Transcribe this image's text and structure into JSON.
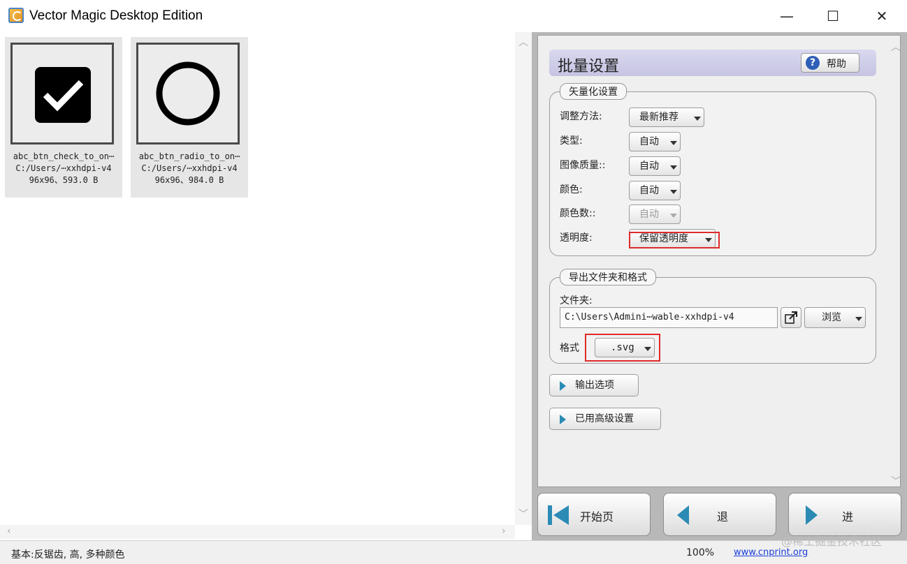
{
  "window": {
    "title": "Vector Magic Desktop Edition",
    "minimize_glyph": "—",
    "maximize_glyph": "☐",
    "close_glyph": "✕",
    "icon": "vector-magic-logo"
  },
  "files": [
    {
      "name": "abc_btn_check_to_on⋯",
      "path": "C:/Users/⋯xxhdpi-v4",
      "info": "96x96、593.0 B",
      "icon": "checkbox-checked-icon"
    },
    {
      "name": "abc_btn_radio_to_on⋯",
      "path": "C:/Users/⋯xxhdpi-v4",
      "info": "96x96、984.0 B",
      "icon": "radio-circle-icon"
    }
  ],
  "panel": {
    "title": "批量设置",
    "help_label": "帮助",
    "vectorize_group": {
      "legend": "矢量化设置",
      "rows": [
        {
          "label": "调整方法:",
          "value": "最新推荐",
          "enabled": true
        },
        {
          "label": "类型:",
          "value": "自动",
          "enabled": true
        },
        {
          "label": "图像质量::",
          "value": "自动",
          "enabled": true
        },
        {
          "label": "颜色:",
          "value": "自动",
          "enabled": true
        },
        {
          "label": "颜色数::",
          "value": "自动",
          "enabled": false
        },
        {
          "label": "透明度:",
          "value": "保留透明度",
          "enabled": true
        }
      ]
    },
    "output_group": {
      "legend": "导出文件夹和格式",
      "folder_label": "文件夹:",
      "folder_path": "C:\\Users\\Admini⋯wable-xxhdpi-v4",
      "browse_label": "浏览",
      "format_label": "格式",
      "format_value": ".svg"
    },
    "output_options_label": "输出选项",
    "advanced_label": "已用高级设置"
  },
  "nav": {
    "start_label": "开始页",
    "back_label": "退",
    "next_label": "进"
  },
  "status": {
    "text": "基本:反锯齿, 高, 多种颜色",
    "zoom": "100%",
    "link": "www.cnprint.org"
  },
  "watermark": "@稀土掘金技术社区",
  "colors": {
    "header_bg": "#c6c4e2",
    "highlight_box": "#e02a2a",
    "arrow_blue": "#2b8bb4",
    "help_icon": "#2f5fb8"
  }
}
